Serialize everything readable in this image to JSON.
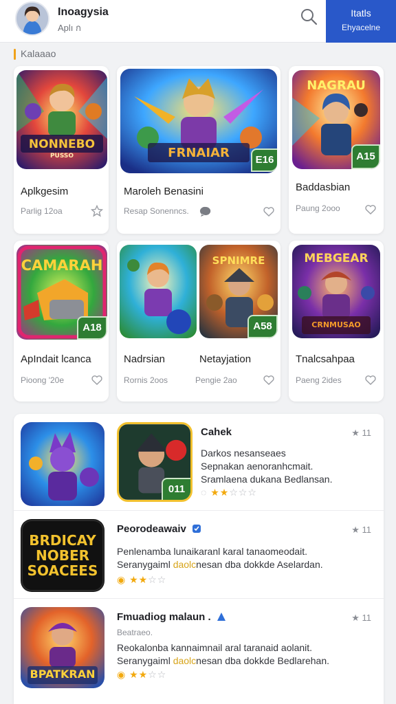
{
  "header": {
    "title": "Inoagysia",
    "subtitle": "Aplı ก",
    "cta_line1": "Itatls",
    "cta_line2": "Ehyacelne"
  },
  "section": {
    "label": "Kalaaao"
  },
  "cards": [
    {
      "art_text": "NONNEBO",
      "art_sub": "PUSSO",
      "title": "Aplkgesim",
      "sub": "Parlig 12oa"
    },
    {
      "art_text": "FRNAIAR",
      "badge": "E16",
      "title": "Maroleh Benasini",
      "sub": "Resap Sonenncs."
    },
    {
      "art_text": "NAGRAU",
      "badge": "A15",
      "title": "Baddasbian",
      "sub": "Paung 2ooo"
    },
    {
      "art_text": "CAMARAH",
      "badge": "A18",
      "title": "ApIndait lcanca",
      "sub": "Pioong '20e"
    },
    {
      "title": "Nadrsian",
      "sub": "Rornis 2oos"
    },
    {
      "art_text": "SPNIMRE",
      "badge": "A58",
      "title": "Netayjation",
      "sub": "Pengie 2ao"
    },
    {
      "art_text": "MEBGEAR",
      "art_sub": "CRNMUSAO",
      "title": "Tnalcsahpaa",
      "sub": "Paeng 2ides"
    }
  ],
  "list": [
    {
      "icon_text": "",
      "thumb_badge": "011",
      "title": "Cahek",
      "desc": [
        "Darkos nesanseaes",
        "Sepnakan aenoranhcmait.",
        "Sramlaena dukana Bedlansan."
      ],
      "stars": 2,
      "count": "11"
    },
    {
      "icon_text": "BRDICAY NOBER SOACEES",
      "title": "Peorodeawaiv",
      "desc_1": "Penlenamba lunaikaranl karal tanaomeodait.",
      "desc_2a": "Seranygaiml ",
      "desc_2b": "daolc",
      "desc_2c": "nesan dba dokkde  Aselardan.",
      "stars": 2,
      "count": "11"
    },
    {
      "icon_text": "BPATKRAN",
      "title": "Fmuadiog malaun .",
      "meta": "Beatraeo.",
      "desc_1": "Reokalonba kannaimnail aral taranaid aolanit.",
      "desc_2a": "Seranygaiml ",
      "desc_2b": "daolc",
      "desc_2c": "nesan dba dokkde  Bedlarehan.",
      "stars": 2,
      "count": "11"
    }
  ],
  "colors": {
    "brand": "#2958c9",
    "accent": "#f0a21a",
    "badge": "#2e7d32",
    "star": "#f2a90e"
  }
}
